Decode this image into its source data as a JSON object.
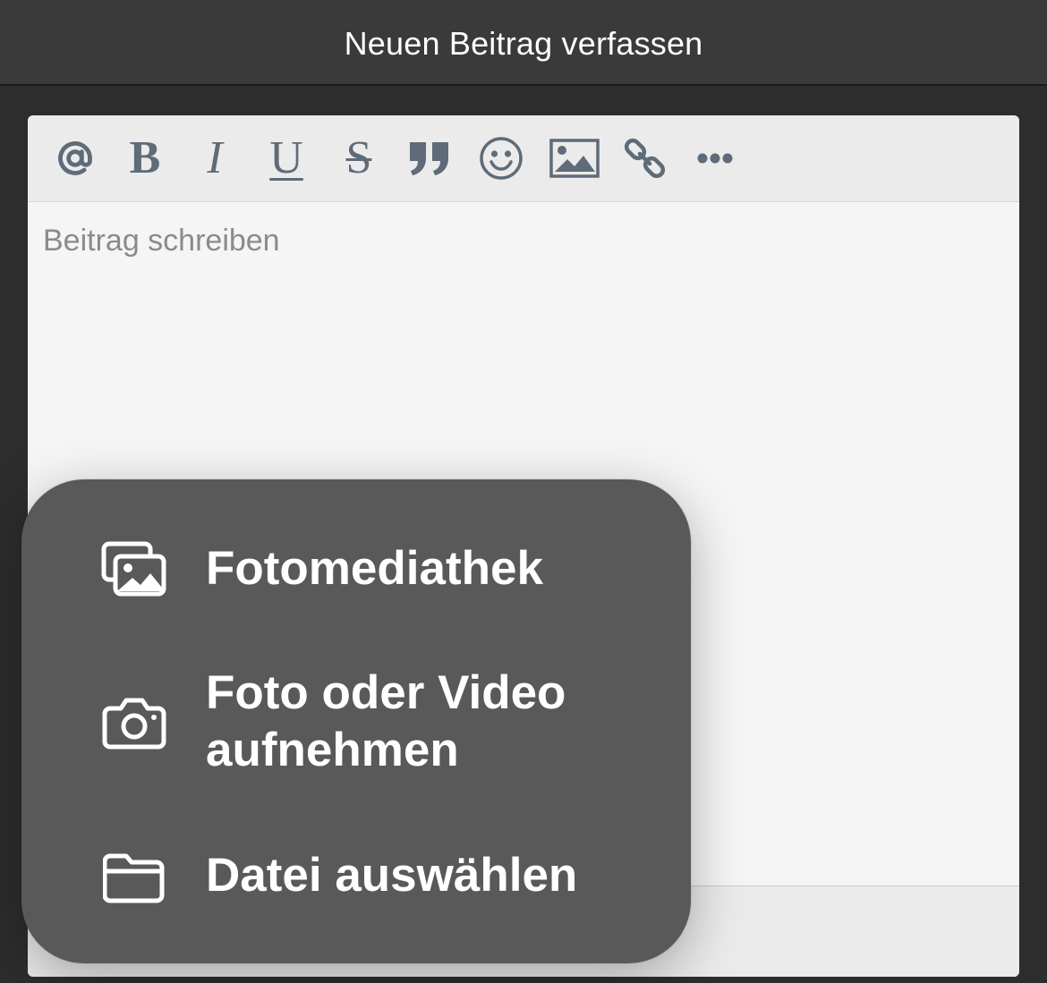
{
  "header": {
    "title": "Neuen Beitrag verfassen"
  },
  "editor": {
    "toolbar": [
      {
        "name": "mention",
        "icon": "at-icon",
        "glyph": "@"
      },
      {
        "name": "bold",
        "icon": "bold-icon",
        "glyph": "B"
      },
      {
        "name": "italic",
        "icon": "italic-icon",
        "glyph": "I"
      },
      {
        "name": "underline",
        "icon": "underline-icon",
        "glyph": "U"
      },
      {
        "name": "strikethrough",
        "icon": "strikethrough-icon",
        "glyph": "S"
      },
      {
        "name": "quote",
        "icon": "quote-icon"
      },
      {
        "name": "emoji",
        "icon": "smiley-icon"
      },
      {
        "name": "image",
        "icon": "image-icon"
      },
      {
        "name": "link",
        "icon": "link-icon"
      },
      {
        "name": "more",
        "icon": "ellipsis-icon"
      }
    ],
    "placeholder": "Beitrag schreiben"
  },
  "attach_menu": {
    "items": [
      {
        "icon": "photo-library-icon",
        "label": "Fotomediathek"
      },
      {
        "icon": "camera-icon",
        "label": "Foto oder Video\naufnehmen"
      },
      {
        "icon": "folder-icon",
        "label": "Datei auswählen"
      }
    ]
  },
  "colors": {
    "background": "#2d2d2d",
    "titlebar": "#3a3a3a",
    "toolbar_icon": "#5f6b78",
    "menu_bg": "#595959",
    "menu_text": "#ffffff",
    "placeholder": "#8b8b8b"
  }
}
